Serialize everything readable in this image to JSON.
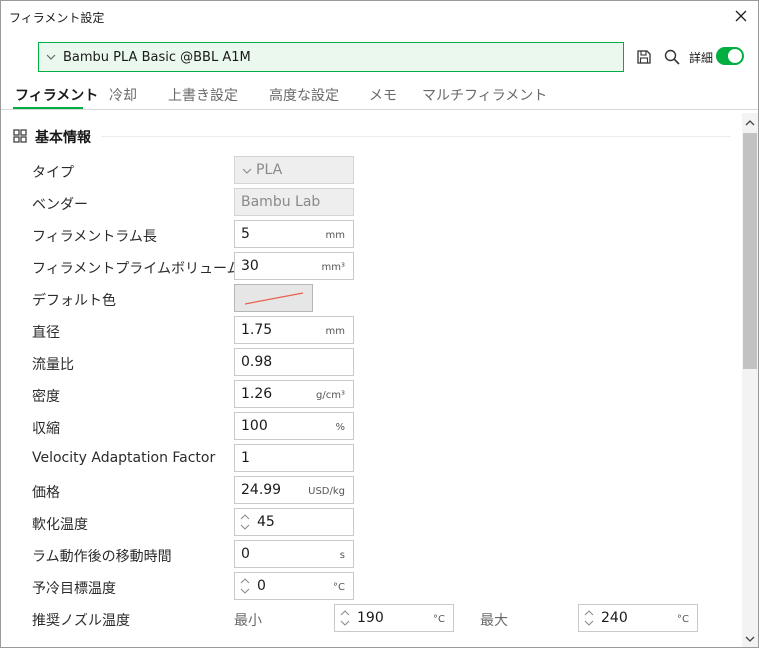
{
  "window": {
    "title": "フィラメント設定"
  },
  "preset": {
    "name": "Bambu PLA Basic @BBL A1M"
  },
  "toolbar": {
    "advanced_label": "詳細",
    "advanced_on": true
  },
  "tabs": [
    {
      "label": "フィラメント",
      "active": true
    },
    {
      "label": "冷却",
      "active": false
    },
    {
      "label": "上書き設定",
      "active": false
    },
    {
      "label": "高度な設定",
      "active": false
    },
    {
      "label": "メモ",
      "active": false
    },
    {
      "label": "マルチフィラメント",
      "active": false
    }
  ],
  "section": {
    "title": "基本情報"
  },
  "fields": {
    "type": {
      "label": "タイプ",
      "value": "PLA"
    },
    "vendor": {
      "label": "ベンダー",
      "value": "Bambu Lab"
    },
    "ram_length": {
      "label": "フィラメントラム長",
      "value": "5",
      "unit": "mm"
    },
    "prime_volume": {
      "label": "フィラメントプライムボリューム",
      "value": "30",
      "unit": "mm³"
    },
    "default_color": {
      "label": "デフォルト色"
    },
    "diameter": {
      "label": "直径",
      "value": "1.75",
      "unit": "mm"
    },
    "flow_ratio": {
      "label": "流量比",
      "value": "0.98"
    },
    "density": {
      "label": "密度",
      "value": "1.26",
      "unit": "g/cm³"
    },
    "shrinkage": {
      "label": "収縮",
      "value": "100",
      "unit": "%"
    },
    "velocity_factor": {
      "label": "Velocity Adaptation Factor",
      "value": "1"
    },
    "price": {
      "label": "価格",
      "value": "24.99",
      "unit": "USD/kg"
    },
    "softening_temp": {
      "label": "軟化温度",
      "value": "45"
    },
    "travel_time": {
      "label": "ラム動作後の移動時間",
      "value": "0",
      "unit": "s"
    },
    "preheat_temp": {
      "label": "予冷目標温度",
      "value": "0",
      "unit": "°C"
    },
    "nozzle_temp": {
      "label": "推奨ノズル温度",
      "min_label": "最小",
      "min_value": "190",
      "min_unit": "°C",
      "max_label": "最大",
      "max_value": "240",
      "max_unit": "°C"
    }
  },
  "colors": {
    "accent": "#00ae42",
    "accent_bg": "#eaf8ee"
  }
}
